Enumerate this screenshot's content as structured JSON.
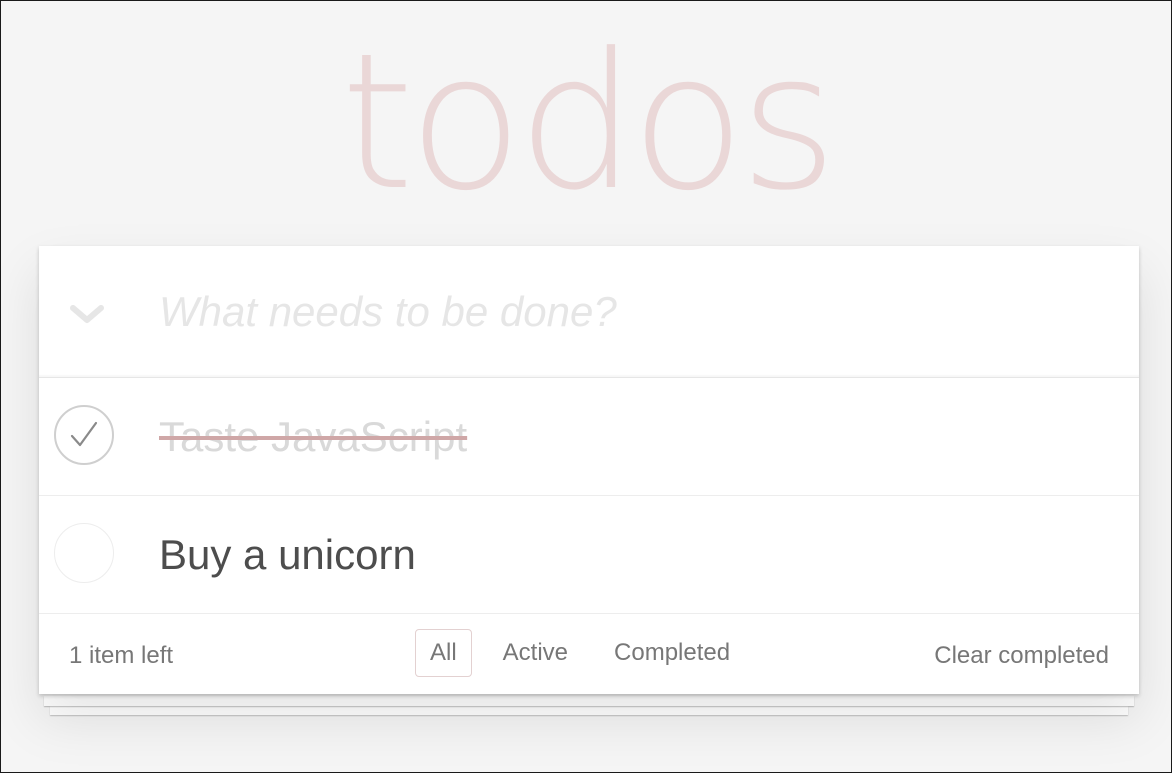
{
  "app_title": "todos",
  "new_todo": {
    "placeholder": "What needs to be done?",
    "value": ""
  },
  "toggle_all_icon": "chevron-down-icon",
  "todos": [
    {
      "label": "Taste JavaScript",
      "completed": true
    },
    {
      "label": "Buy a unicorn",
      "completed": false
    }
  ],
  "footer": {
    "count_text": "1 item left",
    "filters": [
      {
        "label": "All",
        "selected": true
      },
      {
        "label": "Active",
        "selected": false
      },
      {
        "label": "Completed",
        "selected": false
      }
    ],
    "clear_label": "Clear completed"
  },
  "colors": {
    "title": "#efe1e1",
    "background": "#f5f5f5",
    "text": "#4d4d4d",
    "completed_text": "#d9d9d9",
    "selected_filter_border": "#e3d1d1"
  }
}
